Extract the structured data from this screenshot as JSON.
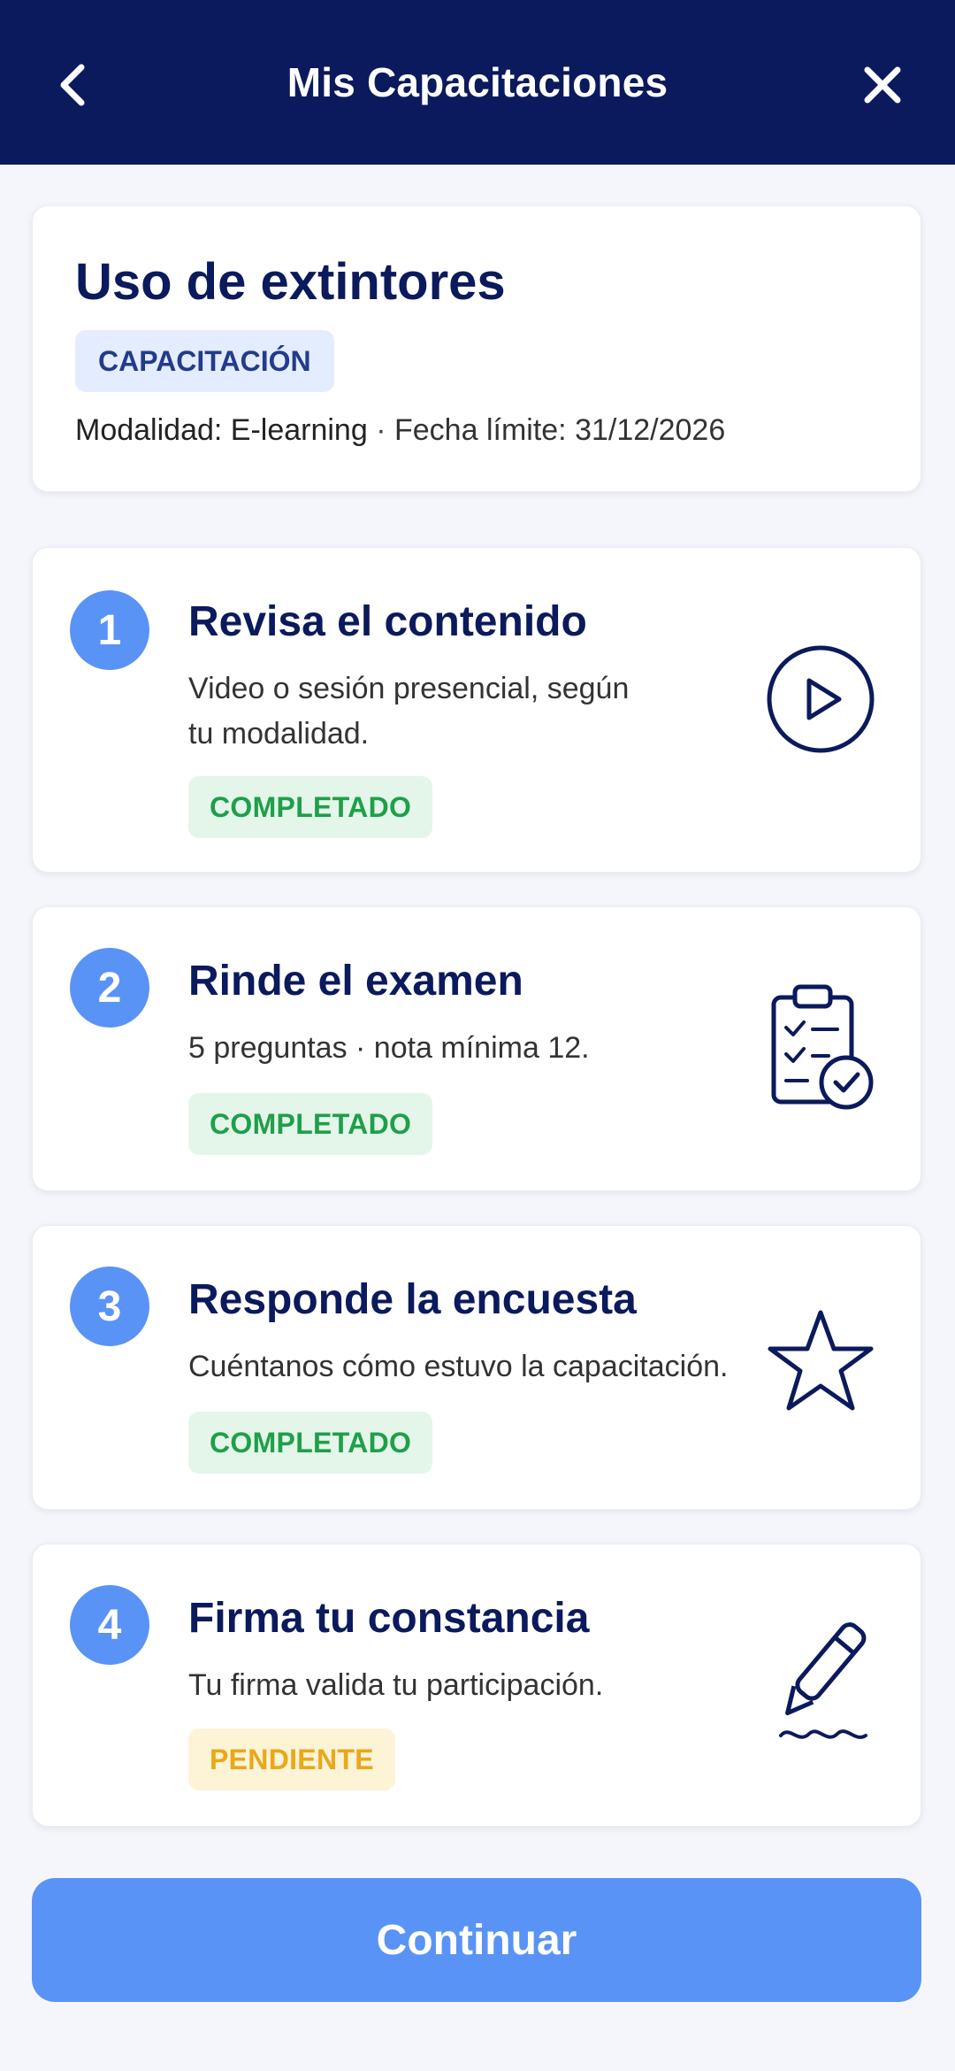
{
  "header": {
    "title": "Mis Capacitaciones",
    "back_icon": "chevron-left-icon",
    "close_icon": "close-icon"
  },
  "course": {
    "title": "Uso de extintores",
    "tag": "CAPACITACIÓN",
    "modality": "Modalidad: E-learning",
    "separator": "·",
    "deadline": "Fecha límite: 31/12/2026"
  },
  "steps": [
    {
      "number": "1",
      "title": "Revisa el contenido",
      "description_line1": "Video o sesión presencial, según",
      "description_line2": "tu modalidad.",
      "status": "COMPLETADO",
      "icon": "play-icon"
    },
    {
      "number": "2",
      "title": "Rinde el examen",
      "description_line1": "5 preguntas · nota mínima 12.",
      "status": "COMPLETADO",
      "icon": "clipboard-check-icon"
    },
    {
      "number": "3",
      "title": "Responde la encuesta",
      "description_line1": "Cuéntanos cómo estuvo la capacitación.",
      "status": "COMPLETADO",
      "icon": "star-icon"
    },
    {
      "number": "4",
      "title": "Firma tu constancia",
      "description_line1": "Tu firma valida tu participación.",
      "status": "PENDIENTE",
      "icon": "pen-signature-icon"
    }
  ],
  "cta": {
    "label": "Continuar"
  },
  "colors": {
    "header_bg": "#0b1a5c",
    "accent": "#5a93f6",
    "completed": "#1f9f4a",
    "pending": "#e9a817"
  }
}
